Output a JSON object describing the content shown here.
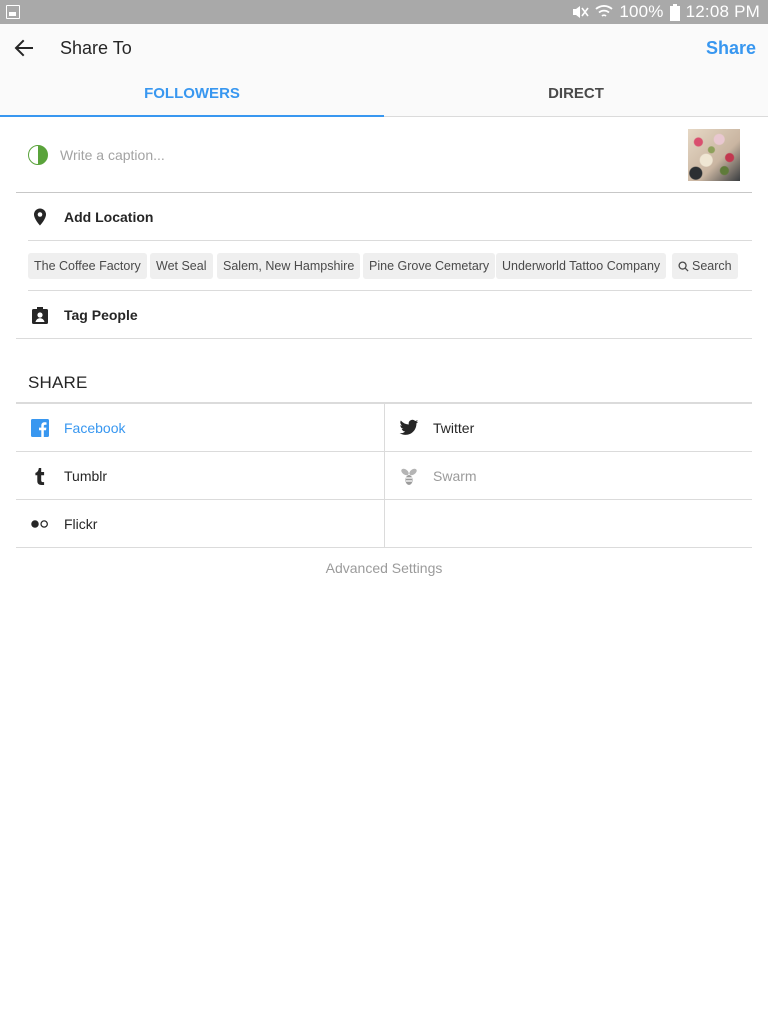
{
  "status_bar": {
    "battery": "100%",
    "time": "12:08 PM"
  },
  "header": {
    "title": "Share To",
    "share_label": "Share"
  },
  "tabs": [
    {
      "label": "FOLLOWERS",
      "active": true
    },
    {
      "label": "DIRECT",
      "active": false
    }
  ],
  "caption": {
    "placeholder": "Write a caption...",
    "value": ""
  },
  "location": {
    "label": "Add Location",
    "suggestions": [
      "The Coffee Factory",
      "Wet Seal",
      "Salem, New Hampshire",
      "Pine Grove Cemetary",
      "Underworld Tattoo Company"
    ],
    "search_label": "Search"
  },
  "tag_people": {
    "label": "Tag People"
  },
  "share_section": {
    "heading": "SHARE",
    "services": [
      {
        "label": "Facebook",
        "icon": "facebook-icon",
        "state": "active"
      },
      {
        "label": "Twitter",
        "icon": "twitter-icon",
        "state": "normal"
      },
      {
        "label": "Tumblr",
        "icon": "tumblr-icon",
        "state": "normal"
      },
      {
        "label": "Swarm",
        "icon": "swarm-icon",
        "state": "disabled"
      },
      {
        "label": "Flickr",
        "icon": "flickr-icon",
        "state": "normal"
      }
    ]
  },
  "advanced_settings": "Advanced Settings",
  "colors": {
    "accent": "#3897f0",
    "status_bar": "#a9a9a9",
    "chip_bg": "#efefef",
    "divider": "#dbdbdb"
  }
}
